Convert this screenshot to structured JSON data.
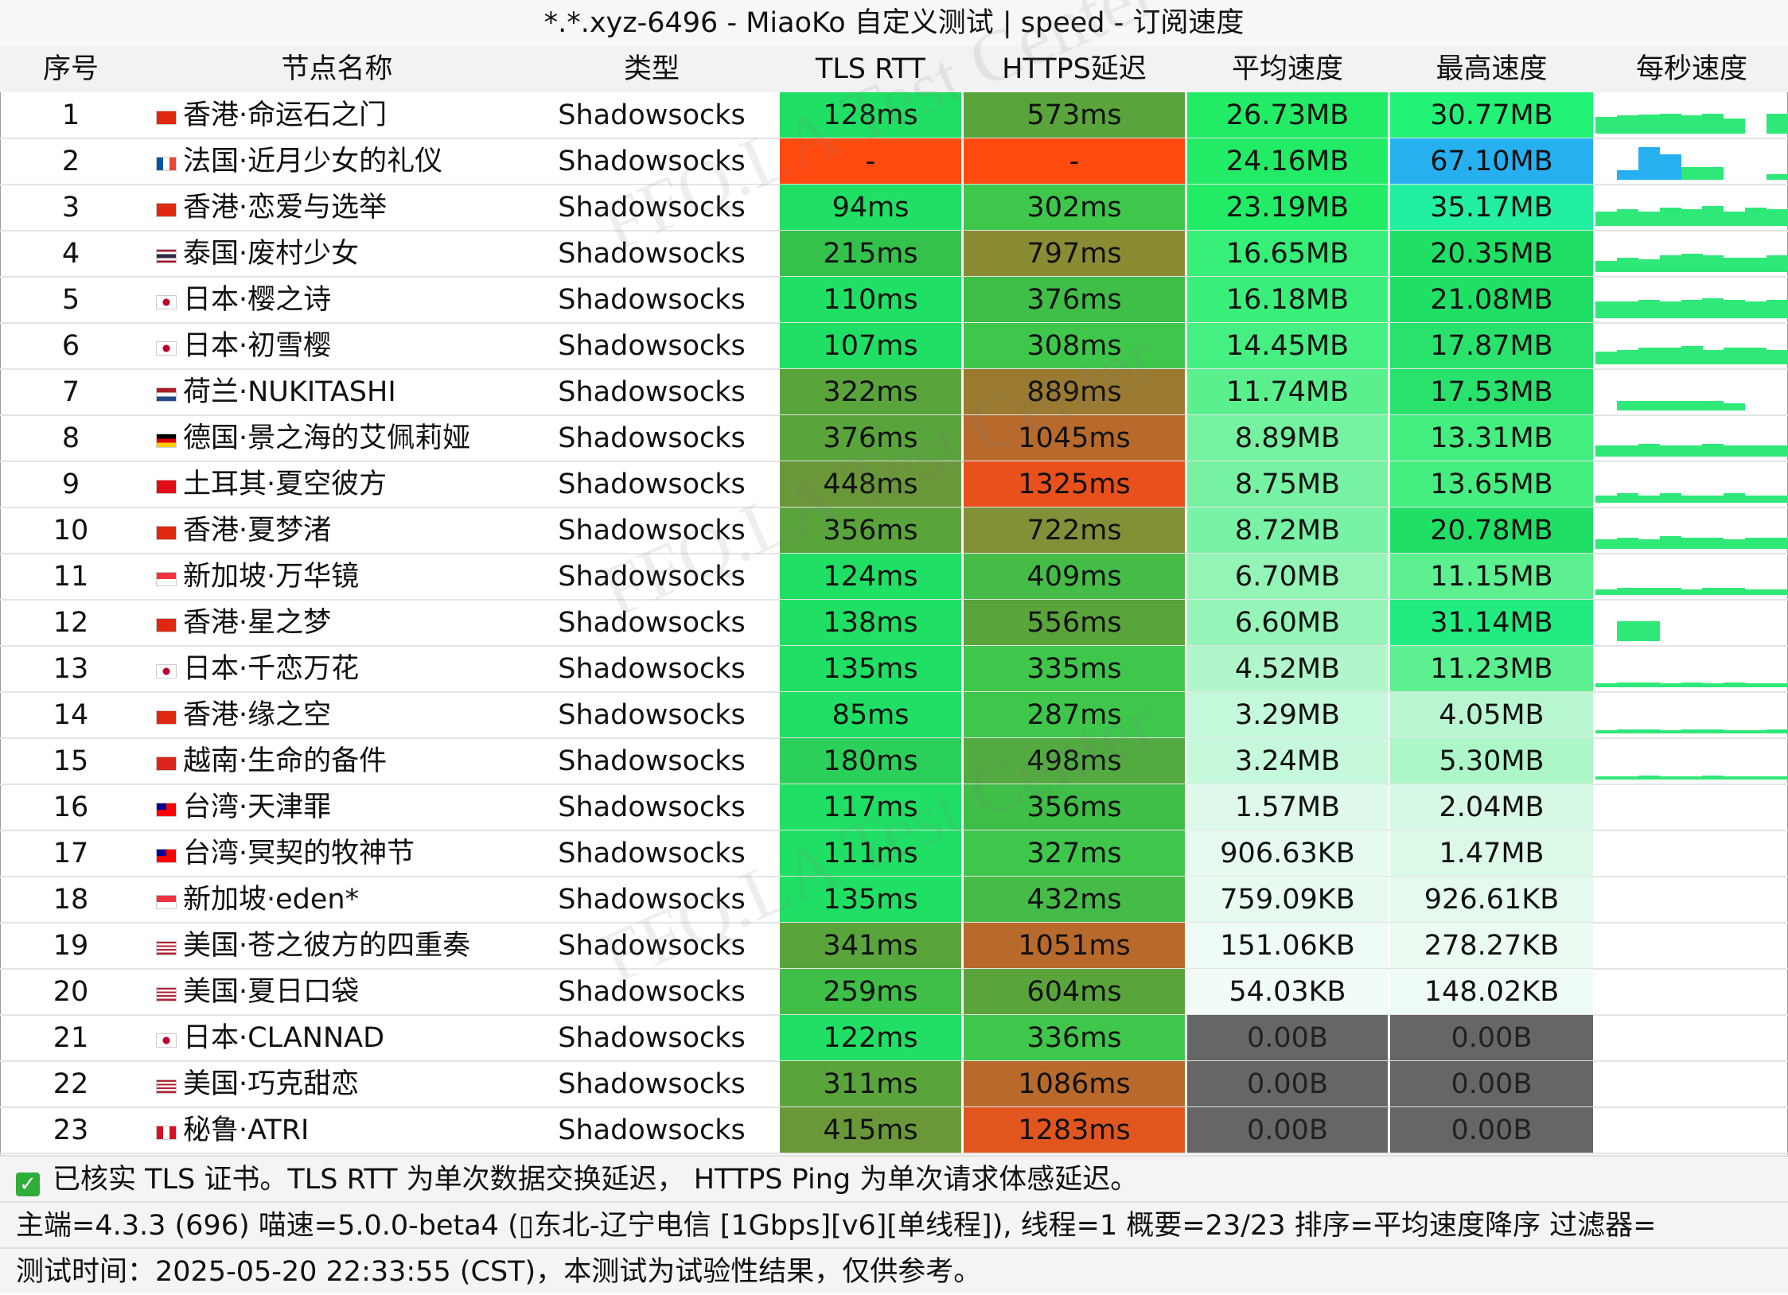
{
  "title": "*.*.xyz-6496 - MiaoKo 自定义测试 | speed - 订阅速度",
  "headers": {
    "idx": "序号",
    "name": "节点名称",
    "type": "类型",
    "tls": "TLS RTT",
    "https": "HTTPS延迟",
    "avg": "平均速度",
    "max": "最高速度",
    "per_sec": "每秒速度"
  },
  "watermark": "FFQ.LA Test Center",
  "rows": [
    {
      "idx": "1",
      "flag": "hk",
      "name": "香港·命运石之门",
      "type": "Shadowsocks",
      "tls": "128ms",
      "https": "573ms",
      "avg": "26.73MB",
      "max": "30.77MB",
      "c": [
        "#1fe064",
        "#5aa43c",
        "#22ec66",
        "#22f276"
      ],
      "spark": [
        0.45,
        0.5,
        0.52,
        0.55,
        0.5,
        0.55,
        0.42,
        0.0,
        0.55
      ]
    },
    {
      "idx": "2",
      "flag": "fr",
      "name": "法国·近月少女的礼仪",
      "type": "Shadowsocks",
      "tls": "-",
      "https": "-",
      "avg": "24.16MB",
      "max": "67.10MB",
      "c": [
        "#ff4a10",
        "#ff4a10",
        "#22ec66",
        "#27b0f0"
      ],
      "spark": [
        0.0,
        0.25,
        0.9,
        0.7,
        0.35,
        0.35,
        0.0,
        0.0,
        0.15
      ]
    },
    {
      "idx": "3",
      "flag": "hk",
      "name": "香港·恋爱与选举",
      "type": "Shadowsocks",
      "tls": "94ms",
      "https": "302ms",
      "avg": "23.19MB",
      "max": "35.17MB",
      "c": [
        "#1fe064",
        "#3fc74c",
        "#22ec66",
        "#22f0a0"
      ],
      "spark": [
        0.4,
        0.45,
        0.4,
        0.5,
        0.45,
        0.55,
        0.4,
        0.5,
        0.45
      ]
    },
    {
      "idx": "4",
      "flag": "th",
      "name": "泰国·废村少女",
      "type": "Shadowsocks",
      "tls": "215ms",
      "https": "797ms",
      "avg": "16.65MB",
      "max": "20.35MB",
      "c": [
        "#35c24c",
        "#8a8c34",
        "#36ee78",
        "#1fe064"
      ],
      "spark": [
        0.3,
        0.4,
        0.35,
        0.45,
        0.5,
        0.45,
        0.4,
        0.4,
        0.45
      ]
    },
    {
      "idx": "5",
      "flag": "jp",
      "name": "日本·樱之诗",
      "type": "Shadowsocks",
      "tls": "110ms",
      "https": "376ms",
      "avg": "16.18MB",
      "max": "21.08MB",
      "c": [
        "#1fe064",
        "#3fbe48",
        "#3aee7a",
        "#1fe064"
      ],
      "spark": [
        0.45,
        0.45,
        0.5,
        0.45,
        0.5,
        0.55,
        0.5,
        0.45,
        0.5
      ]
    },
    {
      "idx": "6",
      "flag": "jp",
      "name": "日本·初雪樱",
      "type": "Shadowsocks",
      "tls": "107ms",
      "https": "308ms",
      "avg": "14.45MB",
      "max": "17.87MB",
      "c": [
        "#1fe064",
        "#3fc74c",
        "#46ef82",
        "#28e26c"
      ],
      "spark": [
        0.35,
        0.4,
        0.45,
        0.45,
        0.5,
        0.4,
        0.45,
        0.45,
        0.4
      ]
    },
    {
      "idx": "7",
      "flag": "nl",
      "name": "荷兰·NUKITASHI",
      "type": "Shadowsocks",
      "tls": "322ms",
      "https": "889ms",
      "avg": "11.74MB",
      "max": "17.53MB",
      "c": [
        "#5aa43c",
        "#9a7a30",
        "#5af08e",
        "#28e26c"
      ],
      "spark": [
        0.0,
        0.25,
        0.25,
        0.25,
        0.25,
        0.25,
        0.2,
        0.0,
        0.0
      ]
    },
    {
      "idx": "8",
      "flag": "de",
      "name": "德国·景之海的艾佩莉娅",
      "type": "Shadowsocks",
      "tls": "376ms",
      "https": "1045ms",
      "avg": "8.89MB",
      "max": "13.31MB",
      "c": [
        "#5aa43c",
        "#b86a2c",
        "#74f2a0",
        "#44ee80"
      ],
      "spark": [
        0.3,
        0.3,
        0.35,
        0.3,
        0.3,
        0.35,
        0.3,
        0.3,
        0.3
      ]
    },
    {
      "idx": "9",
      "flag": "tr",
      "name": "土耳其·夏空彼方",
      "type": "Shadowsocks",
      "tls": "448ms",
      "https": "1325ms",
      "avg": "8.75MB",
      "max": "13.65MB",
      "c": [
        "#6a9838",
        "#e8501c",
        "#76f2a2",
        "#44ee80"
      ],
      "spark": [
        0.2,
        0.25,
        0.2,
        0.25,
        0.2,
        0.2,
        0.25,
        0.2,
        0.2
      ]
    },
    {
      "idx": "10",
      "flag": "hk",
      "name": "香港·夏梦渚",
      "type": "Shadowsocks",
      "tls": "356ms",
      "https": "722ms",
      "avg": "8.72MB",
      "max": "20.78MB",
      "c": [
        "#5aa43c",
        "#829038",
        "#78f2a4",
        "#1fe064"
      ],
      "spark": [
        0.25,
        0.3,
        0.25,
        0.35,
        0.3,
        0.3,
        0.25,
        0.3,
        0.3
      ]
    },
    {
      "idx": "11",
      "flag": "sg",
      "name": "新加坡·万华镜",
      "type": "Shadowsocks",
      "tls": "124ms",
      "https": "409ms",
      "avg": "6.70MB",
      "max": "11.15MB",
      "c": [
        "#1fe064",
        "#45bb48",
        "#94f4b6",
        "#5cf090"
      ],
      "spark": [
        0.15,
        0.2,
        0.2,
        0.2,
        0.15,
        0.2,
        0.2,
        0.15,
        0.15
      ]
    },
    {
      "idx": "12",
      "flag": "hk",
      "name": "香港·星之梦",
      "type": "Shadowsocks",
      "tls": "138ms",
      "https": "556ms",
      "avg": "6.60MB",
      "max": "31.14MB",
      "c": [
        "#1fe064",
        "#5aa43c",
        "#96f4b8",
        "#22ec80"
      ],
      "spark": [
        0.0,
        0.55,
        0.55,
        0.0,
        0.0,
        0.0,
        0.0,
        0.0,
        0.0
      ]
    },
    {
      "idx": "13",
      "flag": "jp",
      "name": "日本·千恋万花",
      "type": "Shadowsocks",
      "tls": "135ms",
      "https": "335ms",
      "avg": "4.52MB",
      "max": "11.23MB",
      "c": [
        "#1fe064",
        "#3fc74c",
        "#b0f6ca",
        "#5cf090"
      ],
      "spark": [
        0.1,
        0.12,
        0.12,
        0.1,
        0.12,
        0.1,
        0.12,
        0.1,
        0.1
      ]
    },
    {
      "idx": "14",
      "flag": "hk",
      "name": "香港·缘之空",
      "type": "Shadowsocks",
      "tls": "85ms",
      "https": "287ms",
      "avg": "3.29MB",
      "max": "4.05MB",
      "c": [
        "#1fe064",
        "#3fc74c",
        "#c4f8da",
        "#b8f6d2"
      ],
      "spark": [
        0.08,
        0.1,
        0.1,
        0.08,
        0.1,
        0.1,
        0.08,
        0.08,
        0.1
      ]
    },
    {
      "idx": "15",
      "flag": "vn",
      "name": "越南·生命的备件",
      "type": "Shadowsocks",
      "tls": "180ms",
      "https": "498ms",
      "avg": "3.24MB",
      "max": "5.30MB",
      "c": [
        "#2ad05a",
        "#52aa40",
        "#c6f8dc",
        "#acf6c8"
      ],
      "spark": [
        0.08,
        0.08,
        0.1,
        0.08,
        0.08,
        0.1,
        0.08,
        0.08,
        0.08
      ]
    },
    {
      "idx": "16",
      "flag": "tw",
      "name": "台湾·天津罪",
      "type": "Shadowsocks",
      "tls": "117ms",
      "https": "356ms",
      "avg": "1.57MB",
      "max": "2.04MB",
      "c": [
        "#1fe064",
        "#3fbe48",
        "#def9ea",
        "#d6f8e4"
      ],
      "spark": [
        0.0,
        0.0,
        0.0,
        0.0,
        0.0,
        0.0,
        0.0,
        0.0,
        0.0
      ]
    },
    {
      "idx": "17",
      "flag": "tw",
      "name": "台湾·冥契的牧神节",
      "type": "Shadowsocks",
      "tls": "111ms",
      "https": "327ms",
      "avg": "906.63KB",
      "max": "1.47MB",
      "c": [
        "#1fe064",
        "#3fc74c",
        "#e6faf0",
        "#dcf9e8"
      ],
      "spark": [
        0.0,
        0.0,
        0.0,
        0.0,
        0.0,
        0.0,
        0.0,
        0.0,
        0.0
      ]
    },
    {
      "idx": "18",
      "flag": "sg",
      "name": "新加坡·eden*",
      "type": "Shadowsocks",
      "tls": "135ms",
      "https": "432ms",
      "avg": "759.09KB",
      "max": "926.61KB",
      "c": [
        "#1fe064",
        "#45bb48",
        "#e8faf0",
        "#e4faee"
      ],
      "spark": [
        0.0,
        0.0,
        0.0,
        0.0,
        0.0,
        0.0,
        0.0,
        0.0,
        0.0
      ]
    },
    {
      "idx": "19",
      "flag": "us",
      "name": "美国·苍之彼方的四重奏",
      "type": "Shadowsocks",
      "tls": "341ms",
      "https": "1051ms",
      "avg": "151.06KB",
      "max": "278.27KB",
      "c": [
        "#5aa43c",
        "#b86a2c",
        "#eefbf4",
        "#ecfbf2"
      ],
      "spark": [
        0.0,
        0.0,
        0.0,
        0.0,
        0.0,
        0.0,
        0.0,
        0.0,
        0.0
      ]
    },
    {
      "idx": "20",
      "flag": "us",
      "name": "美国·夏日口袋",
      "type": "Shadowsocks",
      "tls": "259ms",
      "https": "604ms",
      "avg": "54.03KB",
      "max": "148.02KB",
      "c": [
        "#3fbe48",
        "#5aa43c",
        "#f0fcf5",
        "#eefbf4"
      ],
      "spark": [
        0.0,
        0.0,
        0.0,
        0.0,
        0.0,
        0.0,
        0.0,
        0.0,
        0.0
      ]
    },
    {
      "idx": "21",
      "flag": "jp",
      "name": "日本·CLANNAD",
      "type": "Shadowsocks",
      "tls": "122ms",
      "https": "336ms",
      "avg": "0.00B",
      "max": "0.00B",
      "c": [
        "#1fe064",
        "#3fc74c",
        "#666666",
        "#666666"
      ],
      "spark": [
        0,
        0,
        0,
        0,
        0,
        0,
        0,
        0,
        0
      ]
    },
    {
      "idx": "22",
      "flag": "us",
      "name": "美国·巧克甜恋",
      "type": "Shadowsocks",
      "tls": "311ms",
      "https": "1086ms",
      "avg": "0.00B",
      "max": "0.00B",
      "c": [
        "#5aa43c",
        "#b86a2c",
        "#666666",
        "#666666"
      ],
      "spark": [
        0,
        0,
        0,
        0,
        0,
        0,
        0,
        0,
        0
      ]
    },
    {
      "idx": "23",
      "flag": "pe",
      "name": "秘鲁·ATRI",
      "type": "Shadowsocks",
      "tls": "415ms",
      "https": "1283ms",
      "avg": "0.00B",
      "max": "0.00B",
      "c": [
        "#6a9838",
        "#e0561e",
        "#666666",
        "#666666"
      ],
      "spark": [
        0,
        0,
        0,
        0,
        0,
        0,
        0,
        0,
        0
      ]
    }
  ],
  "footer": {
    "note": "已核实 TLS 证书。TLS RTT 为单次数据交换延迟，  HTTPS Ping 为单次请求体感延迟。",
    "info": "主端=4.3.3 (696) 喵速=5.0.0-beta4 (▯东北-辽宁电信 [1Gbps][v6][单线程]), 线程=1 概要=23/23 排序=平均速度降序 过滤器=",
    "time": "测试时间：2025-05-20 22:33:55 (CST)，本测试为试验性结果，仅供参考。"
  }
}
